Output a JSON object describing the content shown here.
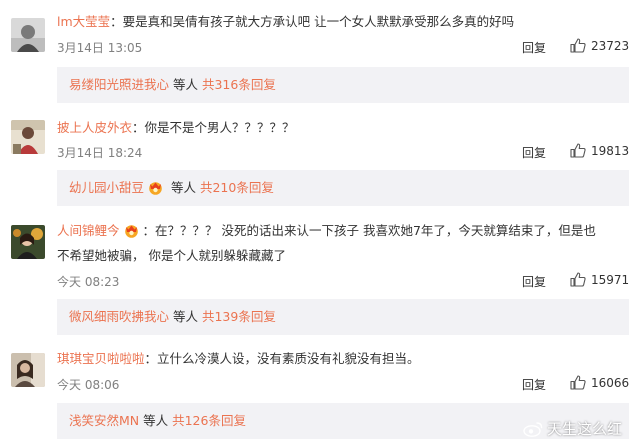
{
  "comments": [
    {
      "username": "lm大莹莹",
      "text": "要是真和吴倩有孩子就大方承认吧 让一个女人默默承受那么多真的好吗",
      "text2": "",
      "time": "3月14日 13:05",
      "reply_label": "回复",
      "likes": "23723",
      "sub_name": "易缕阳光照进我心",
      "sub_mid": " 等人 ",
      "sub_count": "共316条回复"
    },
    {
      "username": "披上人皮外衣",
      "text": "你是不是个男人？？？？？",
      "text2": "",
      "time": "3月14日 18:24",
      "reply_label": "回复",
      "likes": "19813",
      "sub_name": "幼儿园小甜豆",
      "sub_mid": " 等人 ",
      "sub_count": "共210条回复"
    },
    {
      "username": "人间锦鲤今",
      "text": "在？？？？ 没死的话出来认一下孩子  我喜欢她7年了，今天就算结束了，但是也",
      "text2": "不希望她被骗， 你是个人就别躲躲藏藏了",
      "time": "今天 08:23",
      "reply_label": "回复",
      "likes": "15971",
      "sub_name": "微风细雨吹拂我心",
      "sub_mid": " 等人 ",
      "sub_count": "共139条回复"
    },
    {
      "username": "琪琪宝贝啦啦啦",
      "text": "立什么冷漠人设，没有素质没有礼貌没有担当。",
      "text2": "",
      "time": "今天 08:06",
      "reply_label": "回复",
      "likes": "16066",
      "sub_name": "浅笑安然MN",
      "sub_mid": " 等人 ",
      "sub_count": "共126条回复"
    }
  ],
  "watermark": "天生这么红",
  "colors": {
    "username": "#eb7350",
    "meta": "#808080",
    "subbox_bg": "#f2f2f5"
  },
  "icons": [
    "thumbs-up-icon",
    "vip-crown-badge-icon",
    "weibo-logo-icon"
  ]
}
